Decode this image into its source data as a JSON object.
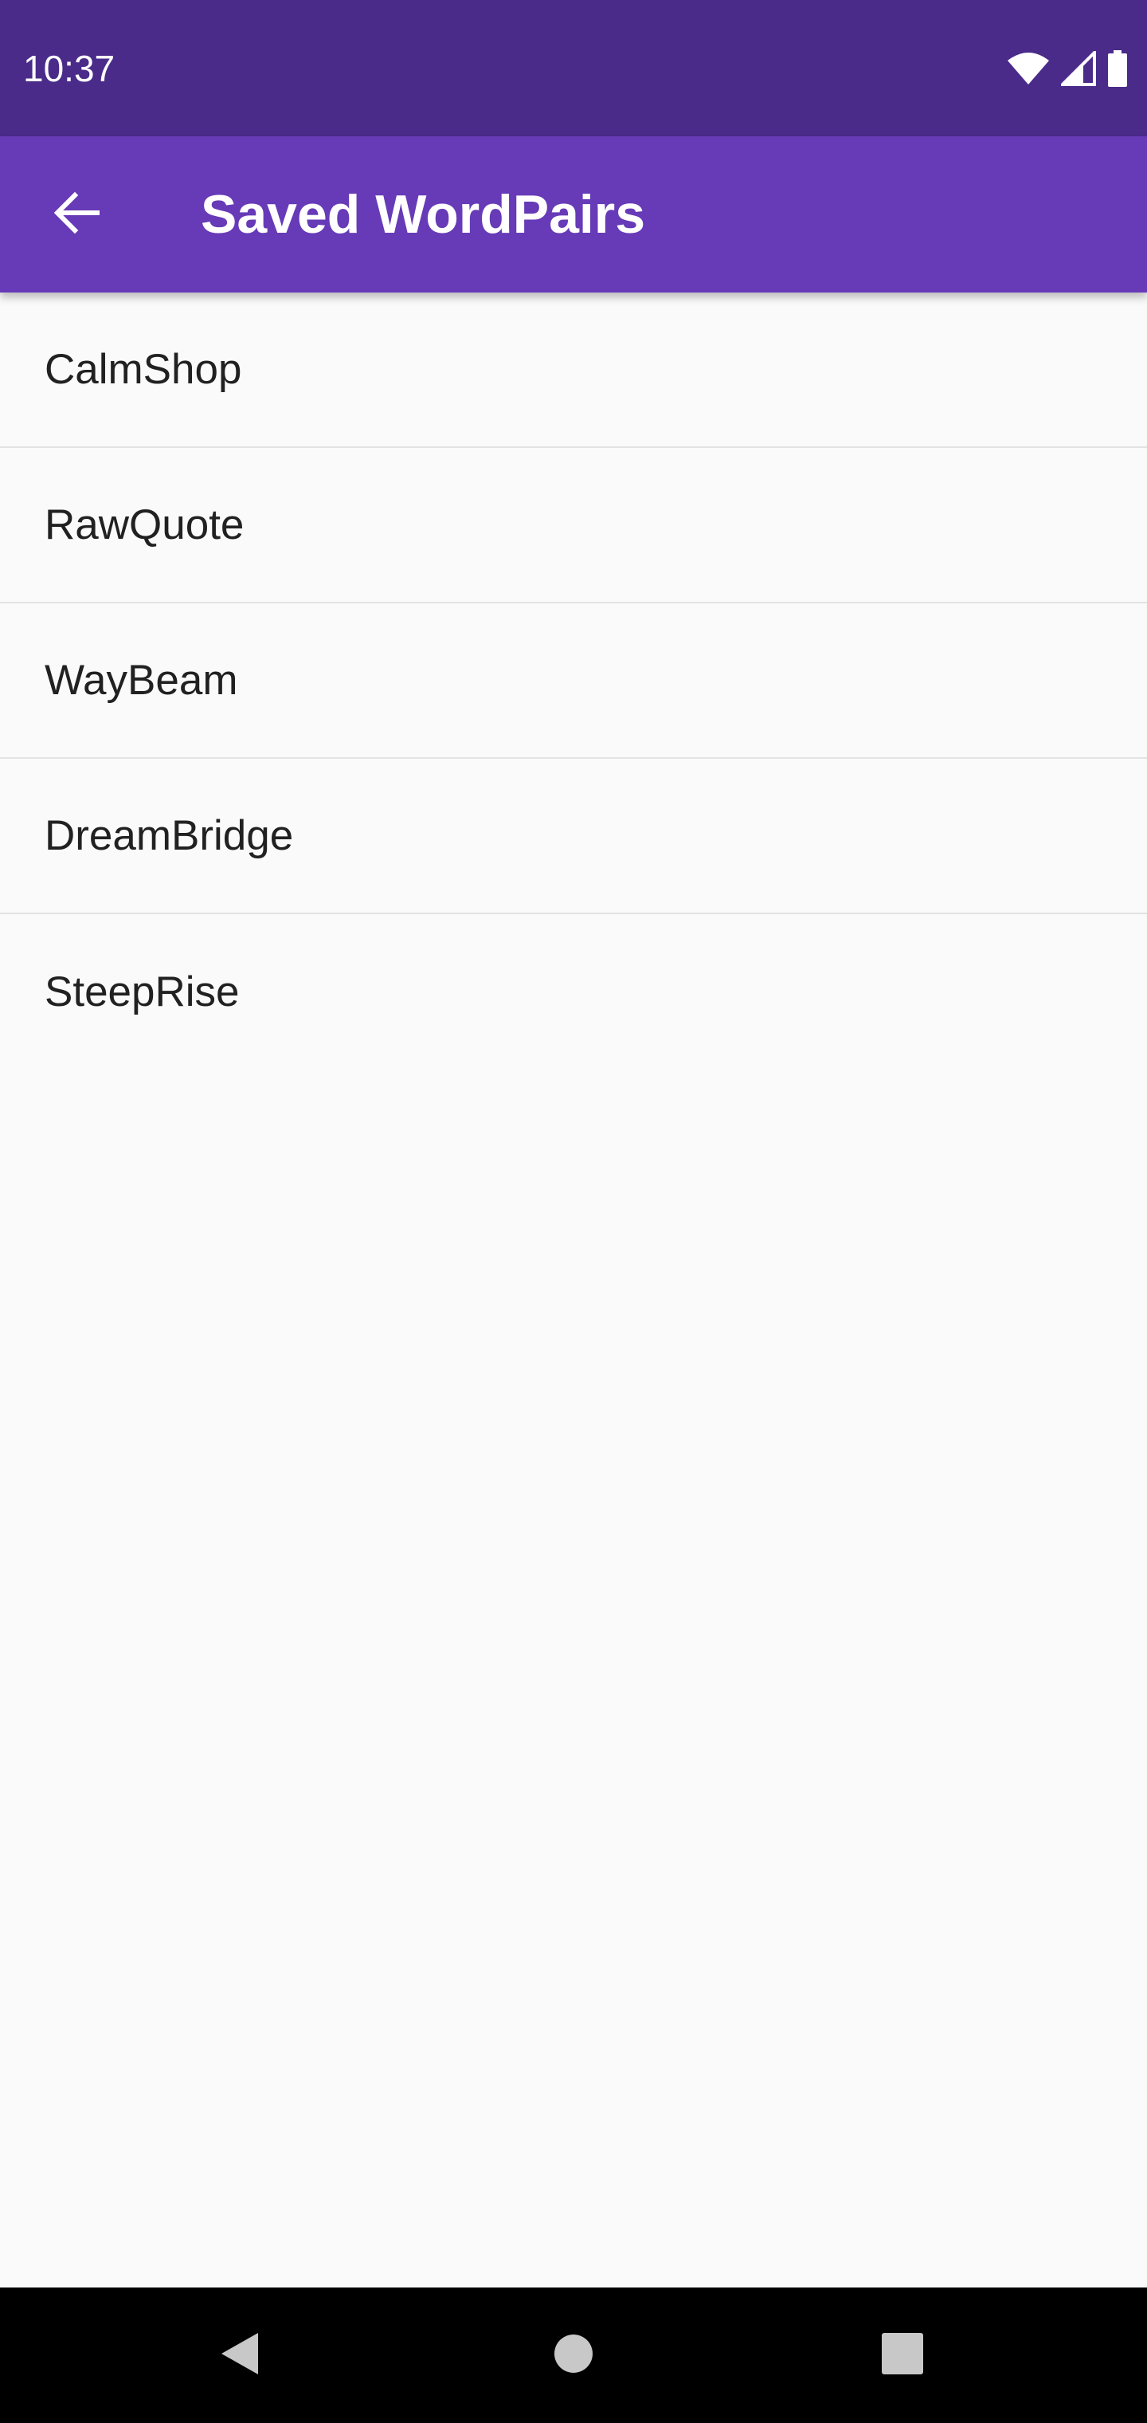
{
  "status_bar": {
    "time": "10:37",
    "icons": [
      "wifi-icon",
      "cellular-signal-icon",
      "battery-icon"
    ]
  },
  "app_bar": {
    "title": "Saved WordPairs",
    "back_icon": "arrow-back-icon"
  },
  "saved_list": {
    "items": [
      {
        "label": "CalmShop"
      },
      {
        "label": "RawQuote"
      },
      {
        "label": "WayBeam"
      },
      {
        "label": "DreamBridge"
      },
      {
        "label": "SteepRise"
      }
    ]
  },
  "nav_bar": {
    "buttons": [
      "back-triangle-icon",
      "home-circle-icon",
      "recents-square-icon"
    ]
  },
  "colors": {
    "status_bar": "#4a2b8a",
    "app_bar": "#673ab7",
    "background": "#fafafa",
    "text": "#212121",
    "divider": "#e3e3e3",
    "nav_bar": "#000000"
  }
}
